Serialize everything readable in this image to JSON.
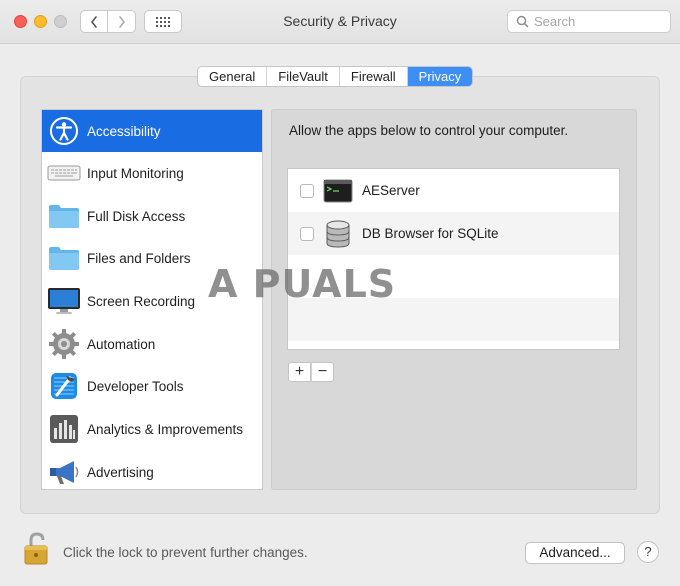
{
  "window": {
    "title": "Security & Privacy"
  },
  "search": {
    "placeholder": "Search"
  },
  "tabs": [
    {
      "label": "General"
    },
    {
      "label": "FileVault"
    },
    {
      "label": "Firewall"
    },
    {
      "label": "Privacy"
    }
  ],
  "sidebar": {
    "items": [
      {
        "label": "Accessibility",
        "icon": "accessibility-icon"
      },
      {
        "label": "Input Monitoring",
        "icon": "keyboard-icon"
      },
      {
        "label": "Full Disk Access",
        "icon": "folder-icon"
      },
      {
        "label": "Files and Folders",
        "icon": "folder-icon"
      },
      {
        "label": "Screen Recording",
        "icon": "display-icon"
      },
      {
        "label": "Automation",
        "icon": "gear-icon"
      },
      {
        "label": "Developer Tools",
        "icon": "xcode-icon"
      },
      {
        "label": "Analytics & Improvements",
        "icon": "bar-chart-icon"
      },
      {
        "label": "Advertising",
        "icon": "megaphone-icon"
      }
    ]
  },
  "content": {
    "description": "Allow the apps below to control your computer.",
    "apps": [
      {
        "name": "AEServer",
        "icon": "terminal-icon"
      },
      {
        "name": "DB Browser for SQLite",
        "icon": "database-icon"
      }
    ],
    "add_label": "+",
    "remove_label": "−"
  },
  "watermark": {
    "text": "A PUALS"
  },
  "footer": {
    "lock_text": "Click the lock to prevent further changes.",
    "advanced_label": "Advanced...",
    "help_label": "?"
  },
  "colors": {
    "accent": "#1a6ce3",
    "tab_active": "#3d8ef5"
  }
}
